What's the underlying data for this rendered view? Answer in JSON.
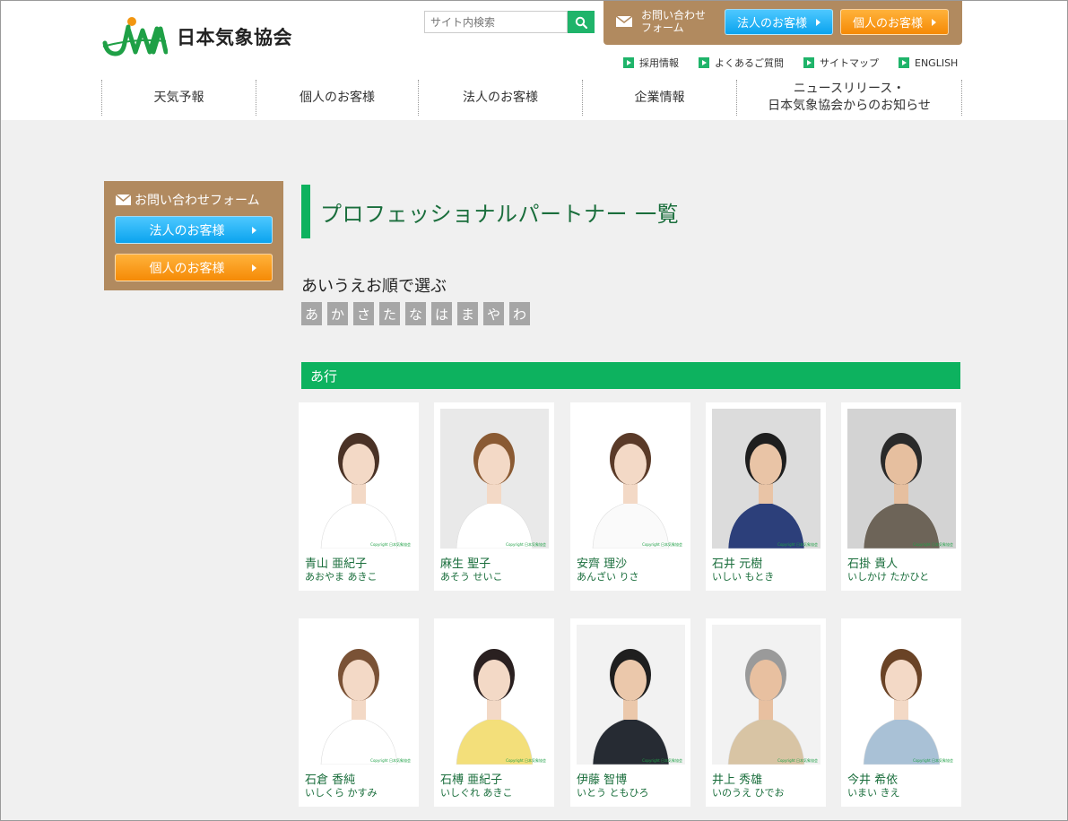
{
  "header": {
    "logo_text": "日本気象協会",
    "search_placeholder": "サイト内検索",
    "contact_label_line1": "お問い合わせ",
    "contact_label_line2": "フォーム",
    "corporate_button": "法人のお客様",
    "personal_button": "個人のお客様",
    "sublinks": [
      "採用情報",
      "よくあるご質問",
      "サイトマップ",
      "ENGLISH"
    ],
    "nav": [
      {
        "label": "天気予報"
      },
      {
        "label": "個人のお客様"
      },
      {
        "label": "法人のお客様"
      },
      {
        "label": "企業情報"
      },
      {
        "label_line1": "ニュースリリース・",
        "label_line2": "日本気象協会からのお知らせ"
      }
    ]
  },
  "sidebar": {
    "title": "お問い合わせフォーム",
    "corporate_button": "法人のお客様",
    "personal_button": "個人のお客様"
  },
  "main": {
    "page_title": "プロフェッショナルパートナー 一覧",
    "select_label": "あいうえお順で選ぶ",
    "kana_index": [
      "あ",
      "か",
      "さ",
      "た",
      "な",
      "は",
      "ま",
      "や",
      "わ"
    ],
    "section_title": "あ行",
    "partners": [
      {
        "name": "青山 亜紀子",
        "kana": "あおやま あきこ",
        "bg": "#ffffff",
        "hair": "#4a3226",
        "clothes": "#ffffff",
        "skin": "#f3d9c6"
      },
      {
        "name": "麻生 聖子",
        "kana": "あそう せいこ",
        "bg": "#e9e9e9",
        "hair": "#8a5a33",
        "clothes": "#ffffff",
        "skin": "#f3d9c6"
      },
      {
        "name": "安齊 理沙",
        "kana": "あんざい りさ",
        "bg": "#ffffff",
        "hair": "#5a3a28",
        "clothes": "#fafafa",
        "skin": "#f3d9c6"
      },
      {
        "name": "石井 元樹",
        "kana": "いしい もとき",
        "bg": "#dcdcdc",
        "hair": "#1e1e1e",
        "clothes": "#2c3f7a",
        "skin": "#e9c4a6"
      },
      {
        "name": "石掛 貴人",
        "kana": "いしかけ たかひと",
        "bg": "#d3d3d3",
        "hair": "#2a2a2a",
        "clothes": "#6d6458",
        "skin": "#e6bf9f"
      },
      {
        "name": "石倉 香純",
        "kana": "いしくら かすみ",
        "bg": "#ffffff",
        "hair": "#7a5236",
        "clothes": "#ffffff",
        "skin": "#f3d9c6"
      },
      {
        "name": "石榑 亜紀子",
        "kana": "いしぐれ あきこ",
        "bg": "#ffffff",
        "hair": "#2a2020",
        "clothes": "#f3df7a",
        "skin": "#f3d9c6"
      },
      {
        "name": "伊藤 智博",
        "kana": "いとう ともひろ",
        "bg": "#f2f2f2",
        "hair": "#1f1f1f",
        "clothes": "#262b33",
        "skin": "#ebc8ab"
      },
      {
        "name": "井上 秀雄",
        "kana": "いのうえ ひでお",
        "bg": "#f2f2f2",
        "hair": "#9a9a9a",
        "clothes": "#d8c4a4",
        "skin": "#e8c0a0"
      },
      {
        "name": "今井 希依",
        "kana": "いまい きえ",
        "bg": "#ffffff",
        "hair": "#6a4326",
        "clothes": "#a9c1d6",
        "skin": "#f3d9c6"
      }
    ]
  }
}
